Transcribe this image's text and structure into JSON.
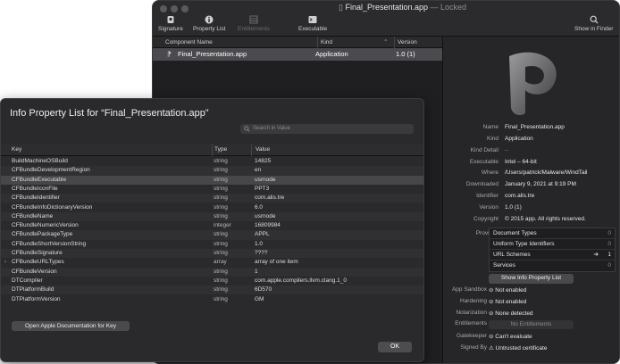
{
  "back": {
    "title": "Final_Presentation.app",
    "title_suffix": "—  Locked",
    "toolbar": [
      "Signature",
      "Property List",
      "Entitlements",
      "Executable"
    ],
    "show_in_finder": "Show in Finder",
    "columns": {
      "name": "Component Name",
      "kind": "Kind",
      "version": "Version"
    },
    "row": {
      "name": "Final_Presentation.app",
      "kind": "Application",
      "version": "1.0 (1)"
    },
    "info": [
      {
        "label": "Name",
        "value": "Final_Presentation.app"
      },
      {
        "label": "Kind",
        "value": "Application"
      },
      {
        "label": "Kind Detail",
        "value": "--"
      },
      {
        "label": "Executable",
        "value": "Intel – 64-bit"
      },
      {
        "label": "Where",
        "value": "/Users/patrick/Malware/WindTail"
      },
      {
        "label": "Downloaded",
        "value": "January 9, 2021 at 9:19 PM"
      },
      {
        "label": "Identifier",
        "value": "com.alis.tre"
      },
      {
        "label": "Version",
        "value": "1.0 (1)"
      },
      {
        "label": "Copyright",
        "value": "© 2015 app. All rights reserved."
      }
    ],
    "provides_label": "Provides",
    "provides": [
      {
        "name": "Document Types",
        "count": "0"
      },
      {
        "name": "Uniform Type Identifiers",
        "count": "0"
      },
      {
        "name": "URL Schemes",
        "count": "1"
      },
      {
        "name": "Services",
        "count": "0"
      }
    ],
    "show_plist_btn": "Show Info Property List",
    "security": [
      {
        "label": "App Sandbox",
        "value": "Not enabled"
      },
      {
        "label": "Hardening",
        "value": "Not enabled"
      },
      {
        "label": "Notarization",
        "value": "None detected"
      },
      {
        "label": "Entitlements",
        "value": "No Entitlements"
      },
      {
        "label": "Gatekeeper",
        "value": "Can't evaluate"
      },
      {
        "label": "Signed By",
        "value": "Untrusted certificate"
      }
    ]
  },
  "sheet": {
    "title": "Info Property List for “Final_Presentation.app”",
    "search_placeholder": "Search in Value",
    "headers": {
      "key": "Key",
      "type": "Type",
      "value": "Value"
    },
    "rows": [
      {
        "key": "BuildMachineOSBuild",
        "type": "string",
        "value": "14825"
      },
      {
        "key": "CFBundleDevelopmentRegion",
        "type": "string",
        "value": "en"
      },
      {
        "key": "CFBundleExecutable",
        "type": "string",
        "value": "usrnode"
      },
      {
        "key": "CFBundleIconFile",
        "type": "string",
        "value": "PPT3"
      },
      {
        "key": "CFBundleIdentifier",
        "type": "string",
        "value": "com.alis.tre"
      },
      {
        "key": "CFBundleInfoDictionaryVersion",
        "type": "string",
        "value": "6.0"
      },
      {
        "key": "CFBundleName",
        "type": "string",
        "value": "usrnode"
      },
      {
        "key": "CFBundleNumericVersion",
        "type": "integer",
        "value": "16809984"
      },
      {
        "key": "CFBundlePackageType",
        "type": "string",
        "value": "APPL"
      },
      {
        "key": "CFBundleShortVersionString",
        "type": "string",
        "value": "1.0"
      },
      {
        "key": "CFBundleSignature",
        "type": "string",
        "value": "????"
      },
      {
        "key": "CFBundleURLTypes",
        "type": "array",
        "value": "array of one item"
      },
      {
        "key": "CFBundleVersion",
        "type": "string",
        "value": "1"
      },
      {
        "key": "DTCompiler",
        "type": "string",
        "value": "com.apple.compilers.llvm.clang.1_0"
      },
      {
        "key": "DTPlatformBuild",
        "type": "string",
        "value": "6D570"
      },
      {
        "key": "DTPlatformVersion",
        "type": "string",
        "value": "GM"
      }
    ],
    "doc_button": "Open Apple Documentation for Key",
    "ok_button": "OK"
  }
}
